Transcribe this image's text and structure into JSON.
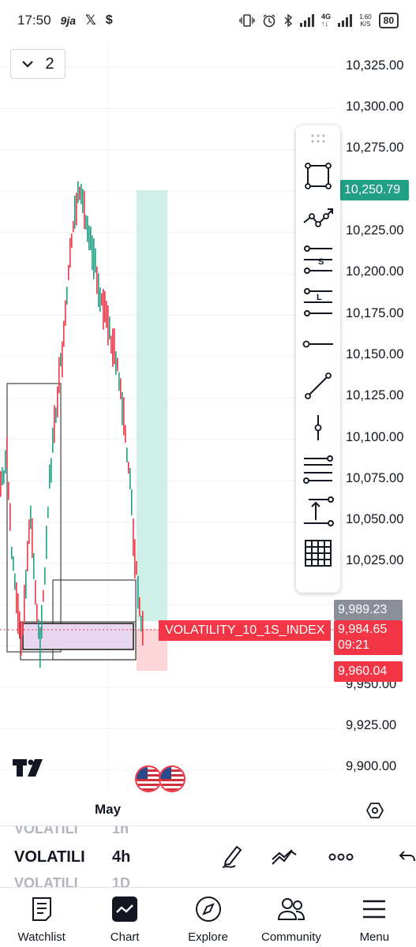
{
  "status_bar": {
    "time": "17:50",
    "app_icons": [
      "9ja-icon",
      "x-icon",
      "s-icon"
    ],
    "net_speed_value": "1.60",
    "net_speed_unit": "K/S",
    "battery": "80"
  },
  "chart": {
    "interval_count": "2",
    "symbol": "VOLATILITY_10_1S_INDEX",
    "price_axis": [
      "10,325.00",
      "10,300.00",
      "10,275.00",
      "10,225.00",
      "10,200.00",
      "10,175.00",
      "10,150.00",
      "10,125.00",
      "10,100.00",
      "10,075.00",
      "10,050.00",
      "10,025.00",
      "9,950.00",
      "9,925.00",
      "9,900.00"
    ],
    "tags": {
      "target": "10,250.79",
      "entry": "9,989.23",
      "last_price": "9,984.65",
      "countdown": "09:21",
      "stop": "9,960.04"
    },
    "time_axis_label": "May",
    "colors": {
      "up": "#22a086",
      "down": "#f23645",
      "target_zone": "#cfeee6",
      "stop_zone": "#fbd5d8",
      "range_box": "#e8d6f1"
    }
  },
  "drawing_tools": [
    "rectangle-icon",
    "path-icon",
    "short-position-icon",
    "long-position-icon",
    "horizontal-ray-icon",
    "trend-line-icon",
    "vertical-line-icon",
    "parallel-channel-icon",
    "price-range-icon",
    "grid-icon"
  ],
  "bottom_toolbar": {
    "symbol_ghost_above": "VOLATILI",
    "interval_ghost_above": "1h",
    "symbol": "VOLATILI",
    "interval": "4h",
    "symbol_ghost_below": "VOLATILI",
    "interval_ghost_below": "1D"
  },
  "tabs": [
    {
      "label": "Watchlist",
      "icon": "watchlist-icon"
    },
    {
      "label": "Chart",
      "icon": "chart-icon"
    },
    {
      "label": "Explore",
      "icon": "compass-icon"
    },
    {
      "label": "Community",
      "icon": "community-icon"
    },
    {
      "label": "Menu",
      "icon": "menu-icon"
    }
  ]
}
